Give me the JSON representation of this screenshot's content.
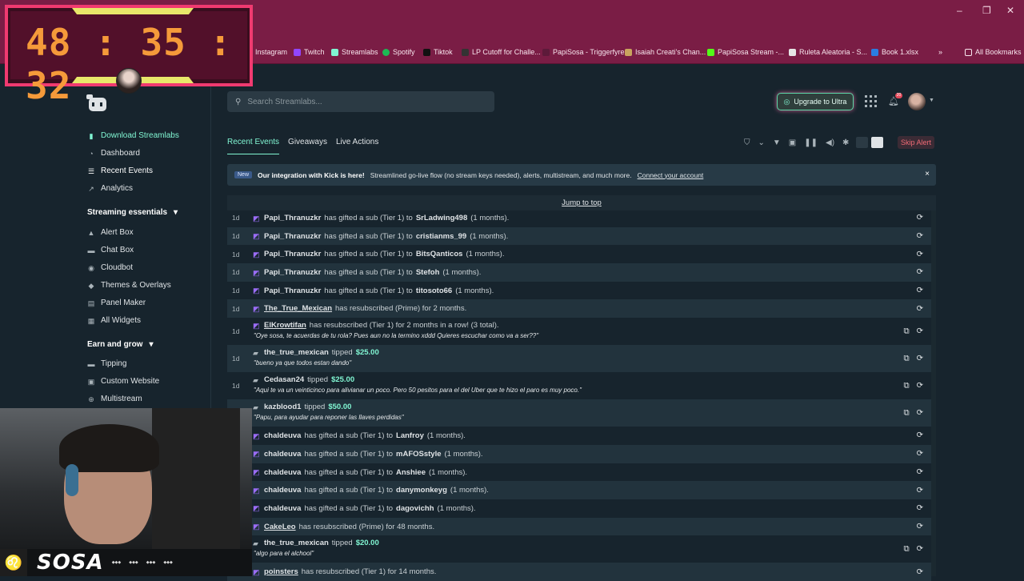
{
  "browser": {
    "bookmarks": [
      "Instagram",
      "Twitch",
      "Streamlabs",
      "Spotify",
      "Tiktok",
      "LP Cutoff for Challe...",
      "PapiSosa - Triggerfyre",
      "Isaiah Creati's Chan...",
      "PapiSosa Stream -...",
      "Ruleta Aleatoria - S...",
      "Book 1.xlsx"
    ],
    "all_bookmarks": "All Bookmarks",
    "overflow": "»"
  },
  "timer": {
    "value": "48 : 35 : 32"
  },
  "sidebar": {
    "download": "Download Streamlabs",
    "dashboard": "Dashboard",
    "recent_events": "Recent Events",
    "analytics": "Analytics",
    "section_streaming": "Streaming essentials",
    "alert_box": "Alert Box",
    "chat_box": "Chat Box",
    "cloudbot": "Cloudbot",
    "themes": "Themes & Overlays",
    "panel_maker": "Panel Maker",
    "all_widgets": "All Widgets",
    "section_earn": "Earn and grow",
    "tipping": "Tipping",
    "custom_website": "Custom Website",
    "multistream": "Multistream"
  },
  "search": {
    "placeholder": "Search Streamlabs..."
  },
  "header": {
    "upgrade": "Upgrade to Ultra",
    "bell_count": "20"
  },
  "tabs": [
    "Recent Events",
    "Giveaways",
    "Live Actions"
  ],
  "skip_alert": "Skip Alert",
  "banner": {
    "badge": "New",
    "title": "Our integration with Kick is here!",
    "body": "Streamlined go-live flow (no stream keys needed), alerts, multistream, and much more.",
    "link": "Connect your account",
    "close": "×"
  },
  "jump_to_top": "Jump to top",
  "events": [
    {
      "age": "1d",
      "user": "Papi_Thranuzkr",
      "text": "has gifted a sub (Tier 1) to",
      "target": "SrLadwing498",
      "suffix": "(1 months)."
    },
    {
      "age": "1d",
      "user": "Papi_Thranuzkr",
      "text": "has gifted a sub (Tier 1) to",
      "target": "cristianms_99",
      "suffix": "(1 months)."
    },
    {
      "age": "1d",
      "user": "Papi_Thranuzkr",
      "text": "has gifted a sub (Tier 1) to",
      "target": "BitsQanticos",
      "suffix": "(1 months)."
    },
    {
      "age": "1d",
      "user": "Papi_Thranuzkr",
      "text": "has gifted a sub (Tier 1) to",
      "target": "Stefoh",
      "suffix": "(1 months)."
    },
    {
      "age": "1d",
      "user": "Papi_Thranuzkr",
      "text": "has gifted a sub (Tier 1) to",
      "target": "titosoto66",
      "suffix": "(1 months)."
    },
    {
      "age": "1d",
      "user": "The_True_Mexican",
      "text": "has resubscribed (Prime) for 2 months.",
      "target": "",
      "suffix": ""
    },
    {
      "age": "1d",
      "user": "ElKrowtifan",
      "text": "has resubscribed (Tier 1) for 2 months in a row! (3 total).",
      "target": "",
      "suffix": "",
      "message": "\"Oye sosa, te acuerdas de tu rola? Pues aun no la termino xddd Quieres escuchar como va a ser??\""
    },
    {
      "age": "1d",
      "user": "the_true_mexican",
      "text": "tipped",
      "amount": "$25.00",
      "message": "\"bueno ya que todos estan dando\""
    },
    {
      "age": "1d",
      "user": "Cedasan24",
      "text": "tipped",
      "amount": "$25.00",
      "message": "\"Aqui te va un veinticinco para alivianar un poco. Pero 50 pesitos para el del Uber que te hizo el paro es muy poco.\""
    },
    {
      "age": "1d",
      "user": "kazblood1",
      "text": "tipped",
      "amount": "$50.00",
      "message": "\"Papu, para ayudar para reponer las llaves perdidas\""
    },
    {
      "age": "",
      "user": "chaldeuva",
      "text": "has gifted a sub (Tier 1) to",
      "target": "Lanfroy",
      "suffix": "(1 months)."
    },
    {
      "age": "",
      "user": "chaldeuva",
      "text": "has gifted a sub (Tier 1) to",
      "target": "mAFOSstyle",
      "suffix": "(1 months)."
    },
    {
      "age": "",
      "user": "chaldeuva",
      "text": "has gifted a sub (Tier 1) to",
      "target": "Anshiee",
      "suffix": "(1 months)."
    },
    {
      "age": "",
      "user": "chaldeuva",
      "text": "has gifted a sub (Tier 1) to",
      "target": "danymonkeyg",
      "suffix": "(1 months)."
    },
    {
      "age": "",
      "user": "chaldeuva",
      "text": "has gifted a sub (Tier 1) to",
      "target": "dagovichh",
      "suffix": "(1 months)."
    },
    {
      "age": "",
      "user": "CakeLeo",
      "text": "has resubscribed (Prime) for 48 months.",
      "target": "",
      "suffix": ""
    },
    {
      "age": "",
      "user": "the_true_mexican",
      "text": "tipped",
      "amount": "$20.00",
      "message": "\"algo para el alchool\""
    },
    {
      "age": "",
      "user": "poinsters",
      "text": "has resubscribed (Tier 1) for 14 months.",
      "target": "",
      "suffix": ""
    }
  ],
  "overlay": {
    "brand": "SOSA"
  }
}
